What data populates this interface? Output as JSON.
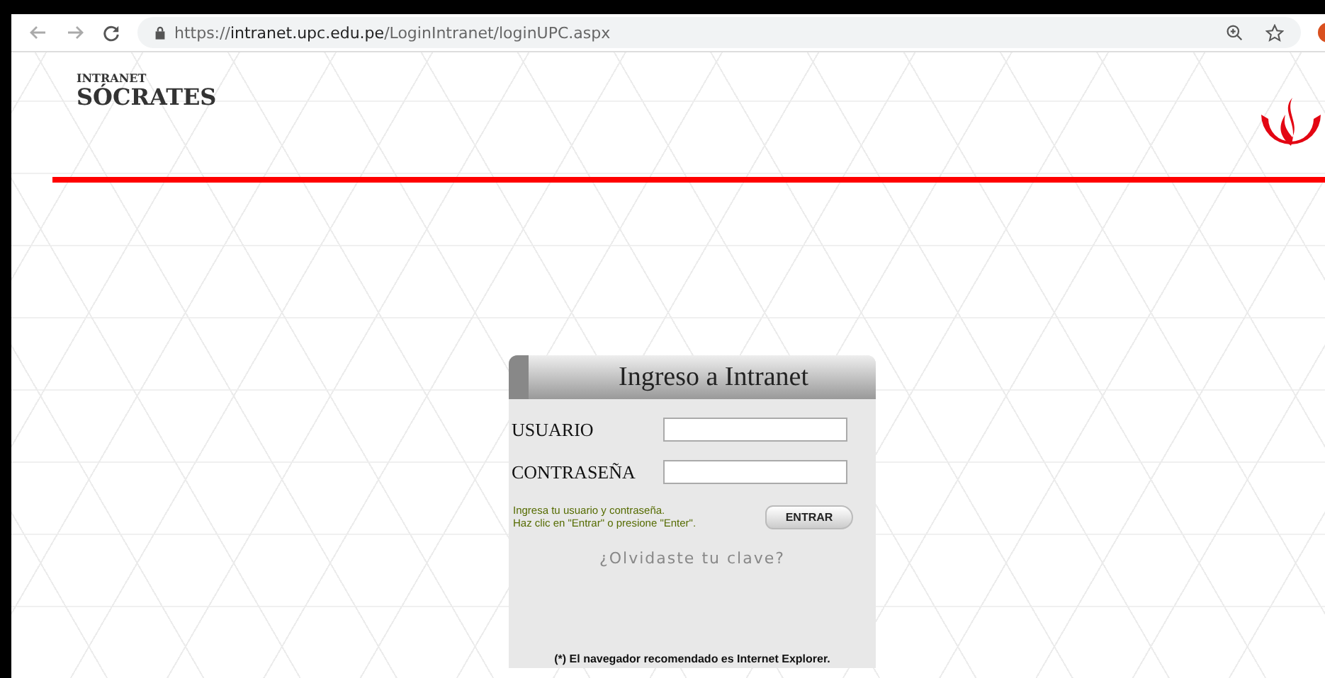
{
  "browser": {
    "url": {
      "scheme": "https://",
      "host": "intranet.upc.edu.pe",
      "path": "/LoginIntranet/loginUPC.aspx"
    }
  },
  "header": {
    "logo_small": "INTRANET",
    "logo_large": "SÓCRATES"
  },
  "login": {
    "title": "Ingreso a Intranet",
    "fields": [
      {
        "label": "USUARIO"
      },
      {
        "label": "CONTRASEÑA"
      }
    ],
    "hint": [
      "Ingresa tu usuario y contraseña.",
      "Haz clic en \"Entrar\" o presione \"Enter\"."
    ],
    "submit": "ENTRAR",
    "forgot": "¿Olvidaste tu clave?",
    "note": "(*) El navegador recomendado es Internet Explorer."
  }
}
